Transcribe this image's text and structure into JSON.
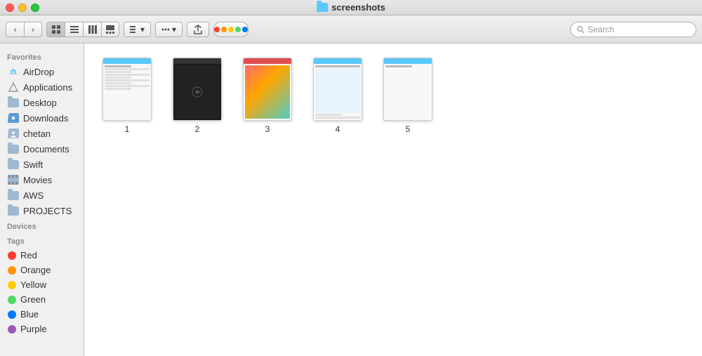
{
  "window": {
    "title": "screenshots"
  },
  "toolbar": {
    "search_placeholder": "Search"
  },
  "sidebar": {
    "favorites_label": "Favorites",
    "devices_label": "Devices",
    "tags_label": "Tags",
    "items": [
      {
        "id": "airdrop",
        "label": "AirDrop",
        "icon": "airdrop"
      },
      {
        "id": "applications",
        "label": "Applications",
        "icon": "applications"
      },
      {
        "id": "desktop",
        "label": "Desktop",
        "icon": "folder"
      },
      {
        "id": "downloads",
        "label": "Downloads",
        "icon": "folder-down"
      },
      {
        "id": "chetan",
        "label": "chetan",
        "icon": "folder-home"
      },
      {
        "id": "documents",
        "label": "Documents",
        "icon": "folder"
      },
      {
        "id": "swift",
        "label": "Swift",
        "icon": "folder"
      },
      {
        "id": "movies",
        "label": "Movies",
        "icon": "folder-movies"
      },
      {
        "id": "aws",
        "label": "AWS",
        "icon": "folder"
      },
      {
        "id": "projects",
        "label": "PROJECTS",
        "icon": "folder"
      }
    ],
    "tags": [
      {
        "id": "red",
        "label": "Red",
        "color": "#ff3b30"
      },
      {
        "id": "orange",
        "label": "Orange",
        "color": "#ff9500"
      },
      {
        "id": "yellow",
        "label": "Yellow",
        "color": "#ffcc00"
      },
      {
        "id": "green",
        "label": "Green",
        "color": "#4cd964"
      },
      {
        "id": "blue",
        "label": "Blue",
        "color": "#007aff"
      },
      {
        "id": "purple",
        "label": "Purple",
        "color": "#9b59b6"
      }
    ]
  },
  "files": [
    {
      "id": 1,
      "label": "1",
      "type": "screenshot-list"
    },
    {
      "id": 2,
      "label": "2",
      "type": "screenshot-dark"
    },
    {
      "id": 3,
      "label": "3",
      "type": "screenshot-colorful"
    },
    {
      "id": 4,
      "label": "4",
      "type": "screenshot-light"
    },
    {
      "id": 5,
      "label": "5",
      "type": "screenshot-blank"
    }
  ],
  "label_dots": [
    "#ff3b30",
    "#ff9500",
    "#ffcc00",
    "#4cd964",
    "#007aff",
    "#9b59b6",
    "#8e8e93"
  ]
}
